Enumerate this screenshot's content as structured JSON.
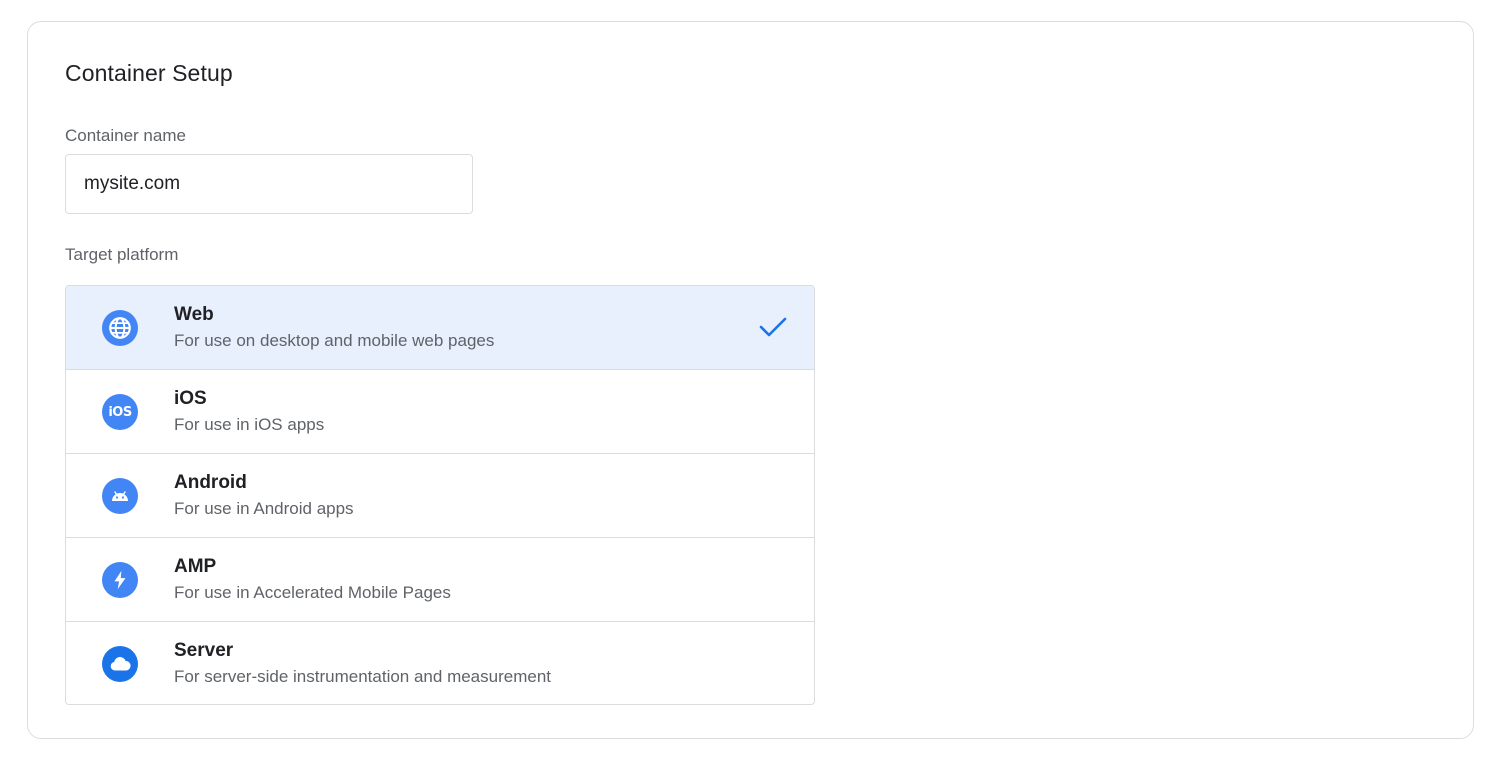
{
  "card": {
    "title": "Container Setup"
  },
  "container_name": {
    "label": "Container name",
    "value": "mysite.com"
  },
  "target_platform": {
    "label": "Target platform",
    "selected": "Web",
    "options": [
      {
        "name": "Web",
        "description": "For use on desktop and mobile web pages",
        "icon": "globe-icon"
      },
      {
        "name": "iOS",
        "description": "For use in iOS apps",
        "icon": "ios-icon",
        "icon_text": "iOS"
      },
      {
        "name": "Android",
        "description": "For use in Android apps",
        "icon": "android-icon"
      },
      {
        "name": "AMP",
        "description": "For use in Accelerated Mobile Pages",
        "icon": "amp-bolt-icon"
      },
      {
        "name": "Server",
        "description": "For server-side instrumentation and measurement",
        "icon": "cloud-icon"
      }
    ]
  },
  "colors": {
    "accent": "#4285f4",
    "check": "#1a73e8",
    "selected_bg": "#e8f0fe",
    "border": "#dadce0"
  }
}
